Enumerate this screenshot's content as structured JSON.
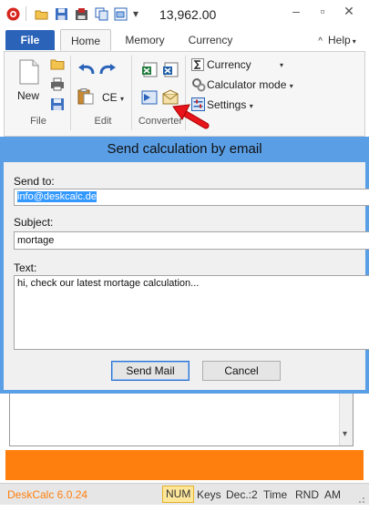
{
  "titlebar": {
    "title": "13,962.00",
    "quick_access_caret": "▾",
    "minimize": "–",
    "restore": "▫",
    "close": "✕"
  },
  "tabs": [
    {
      "label": "File"
    },
    {
      "label": "Home"
    },
    {
      "label": "Memory"
    },
    {
      "label": "Currency"
    }
  ],
  "help": {
    "label": "Help",
    "caret": "▾",
    "chevron": "^"
  },
  "ribbon": {
    "file_group": {
      "label": "File",
      "new_label": "New"
    },
    "edit_group": {
      "label": "Edit",
      "ce_label": "CE",
      "ce_caret": "▾"
    },
    "converter_group": {
      "label": "Converter"
    },
    "options": {
      "currency": "Currency",
      "calculator_mode": "Calculator mode",
      "settings": "Settings",
      "caret": "▾"
    }
  },
  "dialog": {
    "title": "Send calculation by email",
    "send_to_label": "Send to:",
    "send_to_value": "info@deskcalc.de",
    "subject_label": "Subject:",
    "subject_value": "mortage",
    "text_label": "Text:",
    "text_value": "hi, check our latest mortage calculation...",
    "send_button": "Send Mail",
    "cancel_button": "Cancel"
  },
  "statusbar": {
    "app_name": "DeskCalc 6.0.24",
    "num": "NUM",
    "keys": "Keys",
    "dec": "Dec.:2",
    "time": "Time",
    "rnd": "RND",
    "am": "AM"
  },
  "scrollbar": {
    "down_arrow": "▾"
  },
  "colors": {
    "file_tab": "#2a63b8",
    "dialog_frame": "#5a9fe6",
    "accent_orange": "#ff7f0e",
    "selection": "#3399ff",
    "annotation_red": "#e8141c"
  }
}
